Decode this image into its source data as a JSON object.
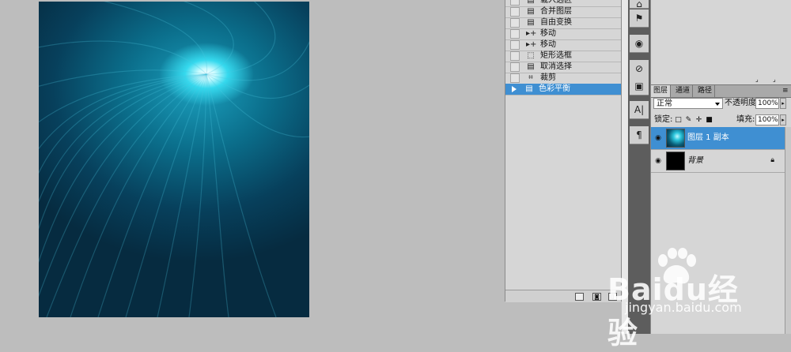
{
  "history": {
    "items": [
      {
        "label": "载入选区",
        "icon": "document-icon"
      },
      {
        "label": "合并图层",
        "icon": "document-icon"
      },
      {
        "label": "自由变换",
        "icon": "document-icon"
      },
      {
        "label": "移动",
        "icon": "move-icon"
      },
      {
        "label": "移动",
        "icon": "move-icon"
      },
      {
        "label": "矩形选框",
        "icon": "marquee-icon"
      },
      {
        "label": "取消选择",
        "icon": "document-icon"
      },
      {
        "label": "裁剪",
        "icon": "crop-icon"
      },
      {
        "label": "色彩平衡",
        "icon": "document-icon",
        "active": true
      }
    ]
  },
  "layers_panel": {
    "tabs": [
      "图层",
      "通道",
      "路径"
    ],
    "blend_mode": "正常",
    "opacity_label": "不透明度:",
    "opacity_value": "100%",
    "lock_label": "锁定:",
    "fill_label": "填充:",
    "fill_value": "100%",
    "layers": [
      {
        "name": "图层 1 副本",
        "selected": true,
        "visible": true
      },
      {
        "name": "背景",
        "selected": false,
        "visible": true,
        "locked": true
      }
    ]
  },
  "watermark": {
    "brand": "Baidu经验",
    "url": "jingyan.baidu.com"
  },
  "colors": {
    "selection": "#3f8fd2",
    "canvas_dark": "#062b40",
    "canvas_glow": "#35d9ee"
  }
}
